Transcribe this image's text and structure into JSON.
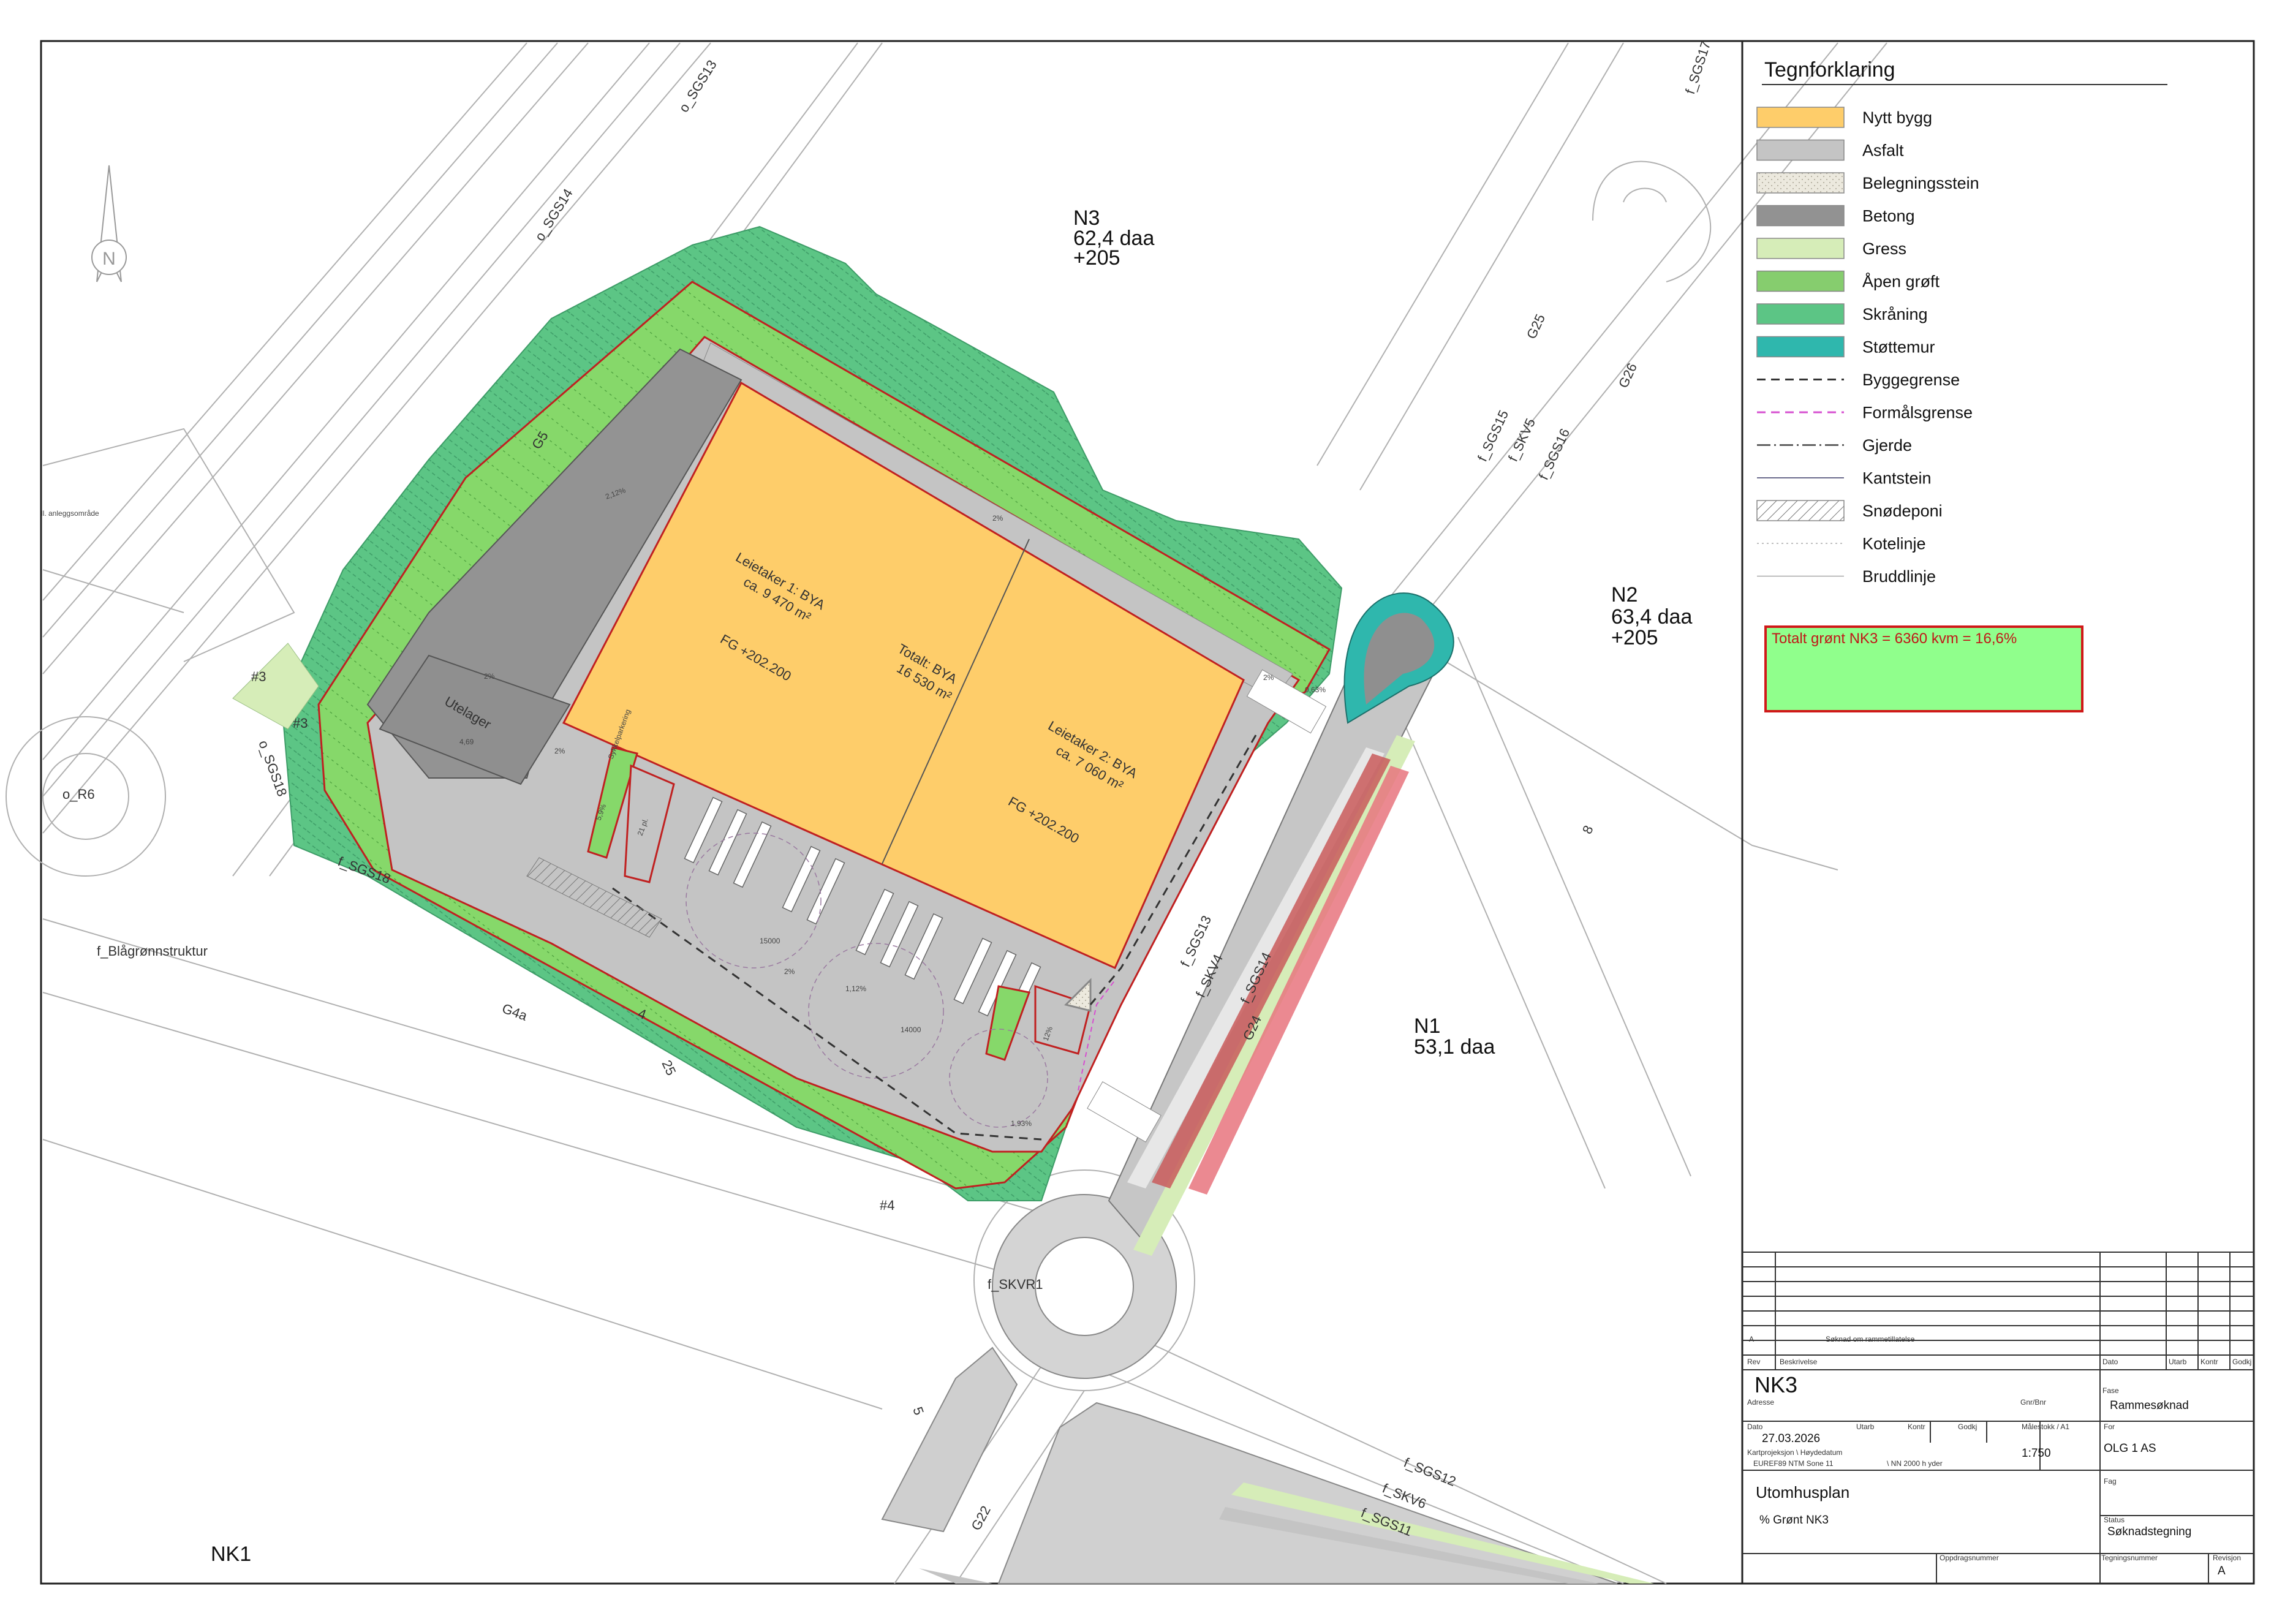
{
  "map": {
    "zones": [
      {
        "name": "N3",
        "area": "62,4 daa",
        "level": "+205"
      },
      {
        "name": "N2",
        "area": "63,4 daa",
        "level": "+205"
      },
      {
        "name": "N1",
        "area": "53,1 daa"
      },
      {
        "name": "NK1"
      }
    ],
    "buildings": {
      "tenant1": {
        "name": "Leietaker 1: BYA",
        "area": "ca. 9 470 m²",
        "fg": "FG +202.200"
      },
      "tenant2": {
        "name": "Leietaker 2: BYA",
        "area": "ca. 7 060 m²",
        "fg": "FG +202.200"
      },
      "total": {
        "name": "Totalt: BYA",
        "area": "16 530 m²"
      },
      "utelager": "Utelager"
    },
    "road_labels": [
      "o_SGS13",
      "o_SGS14",
      "f_SGS17",
      "f_SGS15",
      "f_SKV5",
      "f_SGS16",
      "G25",
      "G26",
      "G5",
      "#3",
      "#3",
      "o_SGS18",
      "o_R6",
      "f_SGS18",
      "f_Blågrønnstruktur",
      "G4a",
      "4",
      "25",
      "#4",
      "f_SKVR1",
      "5",
      "G22",
      "f_SGS12",
      "f_SKV6",
      "f_SGS11",
      "f_SGS13",
      "f_SKV4",
      "f_SGS14",
      "G24",
      "8",
      "ll. anleggsområde"
    ],
    "slope_labels": [
      "2,12%",
      "2%",
      "2%",
      "2%",
      "4,69",
      "2%",
      "0,63%",
      "2%",
      "5,9%",
      "12%",
      "1,93%",
      "1,12%"
    ],
    "measure_labels": [
      "15000",
      "14000",
      "21 pl.",
      "Sykkelparkering"
    ],
    "note": {
      "text": "Totalt grønt NK3 = 6360 kvm = 16,6%",
      "fill": "#90ff8c",
      "border": "#d01818"
    }
  },
  "legend": {
    "title": "Tegnforklaring",
    "items": [
      {
        "label": "Nytt bygg",
        "color": "#fecd6a",
        "style": "fill"
      },
      {
        "label": "Asfalt",
        "color": "#c4c4c4",
        "style": "fill"
      },
      {
        "label": "Belegningsstein",
        "color": "#e9e6dc",
        "style": "speckle"
      },
      {
        "label": "Betong",
        "color": "#929292",
        "style": "fill"
      },
      {
        "label": "Gress",
        "color": "#d6edb8",
        "style": "fill"
      },
      {
        "label": "Åpen grøft",
        "color": "#86cd6e",
        "style": "fill"
      },
      {
        "label": "Skråning",
        "color": "#5cc585",
        "style": "fill"
      },
      {
        "label": "Støttemur",
        "color": "#2fb7ad",
        "style": "fill"
      },
      {
        "label": "Byggegrense",
        "color": "#333333",
        "style": "dash"
      },
      {
        "label": "Formålsgrense",
        "color": "#d64fd0",
        "style": "dash"
      },
      {
        "label": "Gjerde",
        "color": "#444444",
        "style": "fence"
      },
      {
        "label": "Kantstein",
        "color": "#6a6a8c",
        "style": "line"
      },
      {
        "label": "Snødeponi",
        "color": "#888888",
        "style": "hatch"
      },
      {
        "label": "Kotelinje",
        "color": "#aaaaaa",
        "style": "dotted"
      },
      {
        "label": "Bruddlinje",
        "color": "#999999",
        "style": "thin"
      }
    ]
  },
  "title_block": {
    "revision_row": {
      "rev": "A",
      "description": "Søknad om rammetillatelse"
    },
    "headers": {
      "rev": "Rev",
      "beskrivelse": "Beskrivelse",
      "dato": "Dato",
      "utarb": "Utarb",
      "kontr": "Kontr",
      "godkj": "Godkj"
    },
    "project": "NK3",
    "adresse_label": "Adresse",
    "gnr_label": "Gnr/Bnr",
    "fase_label": "Fase",
    "fase": "Rammesøknad",
    "dato_label": "Dato",
    "date": "27.03.2026",
    "utarb_label": "Utarb",
    "kontr_label": "Kontr",
    "godkj_label": "Godkj",
    "malestokk_label": "Målestokk / A1",
    "scale": "1:750",
    "for_label": "For",
    "client": "OLG 1 AS",
    "kart_label": "Kartprojeksjon \\ Høydedatum",
    "projection": "EUREF89 NTM Sone 11",
    "datum": "\\ NN 2000 h yder",
    "fag_label": "Fag",
    "title1": "Utomhusplan",
    "title2": "% Grønt NK3",
    "status_label": "Status",
    "status": "Søknadstegning",
    "oppdrag_label": "Oppdragsnummer",
    "tegning_label": "Tegningsnummer",
    "revisjon_label": "Revisjon",
    "revision": "A"
  }
}
